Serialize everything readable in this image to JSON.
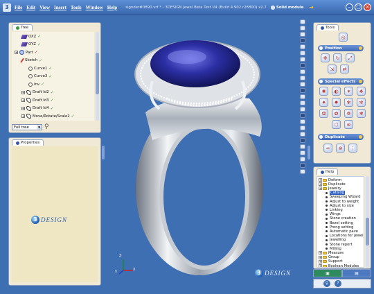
{
  "window": {
    "menu": [
      "File",
      "Edit",
      "View",
      "Insert",
      "Tools",
      "Window",
      "Help"
    ],
    "doc_title": "signder#0890.vrf * - 3DESIGN Jewel Beta Test V4 (Build 4.902 r28800) x2.7",
    "solid_mode": "Solid module"
  },
  "tree": {
    "tab": "Tree",
    "items": [
      {
        "label": "OXZ",
        "type": "plane",
        "indent": 1
      },
      {
        "label": "OYZ",
        "type": "plane",
        "indent": 1
      },
      {
        "label": "Part",
        "type": "part",
        "indent": 0
      },
      {
        "label": "Sketch",
        "type": "sketch",
        "indent": 1
      },
      {
        "label": "Curve1",
        "type": "curve",
        "indent": 2
      },
      {
        "label": "Curve3",
        "type": "curve",
        "indent": 2
      },
      {
        "label": "inv",
        "type": "curve",
        "indent": 2
      },
      {
        "label": "Draft Id2",
        "type": "draft",
        "indent": 1
      },
      {
        "label": "Draft Id3",
        "type": "draft",
        "indent": 1
      },
      {
        "label": "Draft Id4",
        "type": "draft",
        "indent": 1
      },
      {
        "label": "Move/Rotate/Scale2",
        "type": "draft",
        "indent": 1
      }
    ],
    "filter_value": "Full tree"
  },
  "properties": {
    "tab": "Properties",
    "logo": "DESIGN"
  },
  "viewport": {
    "axis": {
      "x": "X",
      "y": "Y",
      "z": "Z"
    },
    "logo": "DESIGN"
  },
  "tools": {
    "tab": "Tools",
    "sections": [
      "Position",
      "Special effects",
      "Duplicate"
    ]
  },
  "help": {
    "tab": "Help",
    "items": [
      {
        "label": "Deform",
        "kind": "folder"
      },
      {
        "label": "Duplicate",
        "kind": "folder"
      },
      {
        "label": "Jewelry",
        "kind": "folder"
      },
      {
        "label": "Catalog",
        "kind": "item",
        "selected": true
      },
      {
        "label": "Sweeping Wizard",
        "kind": "item"
      },
      {
        "label": "Adjust to weight",
        "kind": "item"
      },
      {
        "label": "Adjust to size",
        "kind": "item"
      },
      {
        "label": "Linking",
        "kind": "item"
      },
      {
        "label": "Wings",
        "kind": "item"
      },
      {
        "label": "Stone creation",
        "kind": "item"
      },
      {
        "label": "Bezel setting",
        "kind": "item"
      },
      {
        "label": "Prong setting",
        "kind": "item"
      },
      {
        "label": "Automatic pave",
        "kind": "item"
      },
      {
        "label": "Locations for jewelling",
        "kind": "item"
      },
      {
        "label": "Jewelling",
        "kind": "item"
      },
      {
        "label": "Stone report",
        "kind": "item"
      },
      {
        "label": "Milling",
        "kind": "item"
      },
      {
        "label": "Measure",
        "kind": "folder"
      },
      {
        "label": "Group",
        "kind": "folder"
      },
      {
        "label": "Support",
        "kind": "folder"
      },
      {
        "label": "Boolean Modules",
        "kind": "folder"
      }
    ]
  },
  "colors": {
    "accent": "#3e6fb3",
    "gem": "#2a2e9c",
    "metal": "#d9dde3"
  }
}
